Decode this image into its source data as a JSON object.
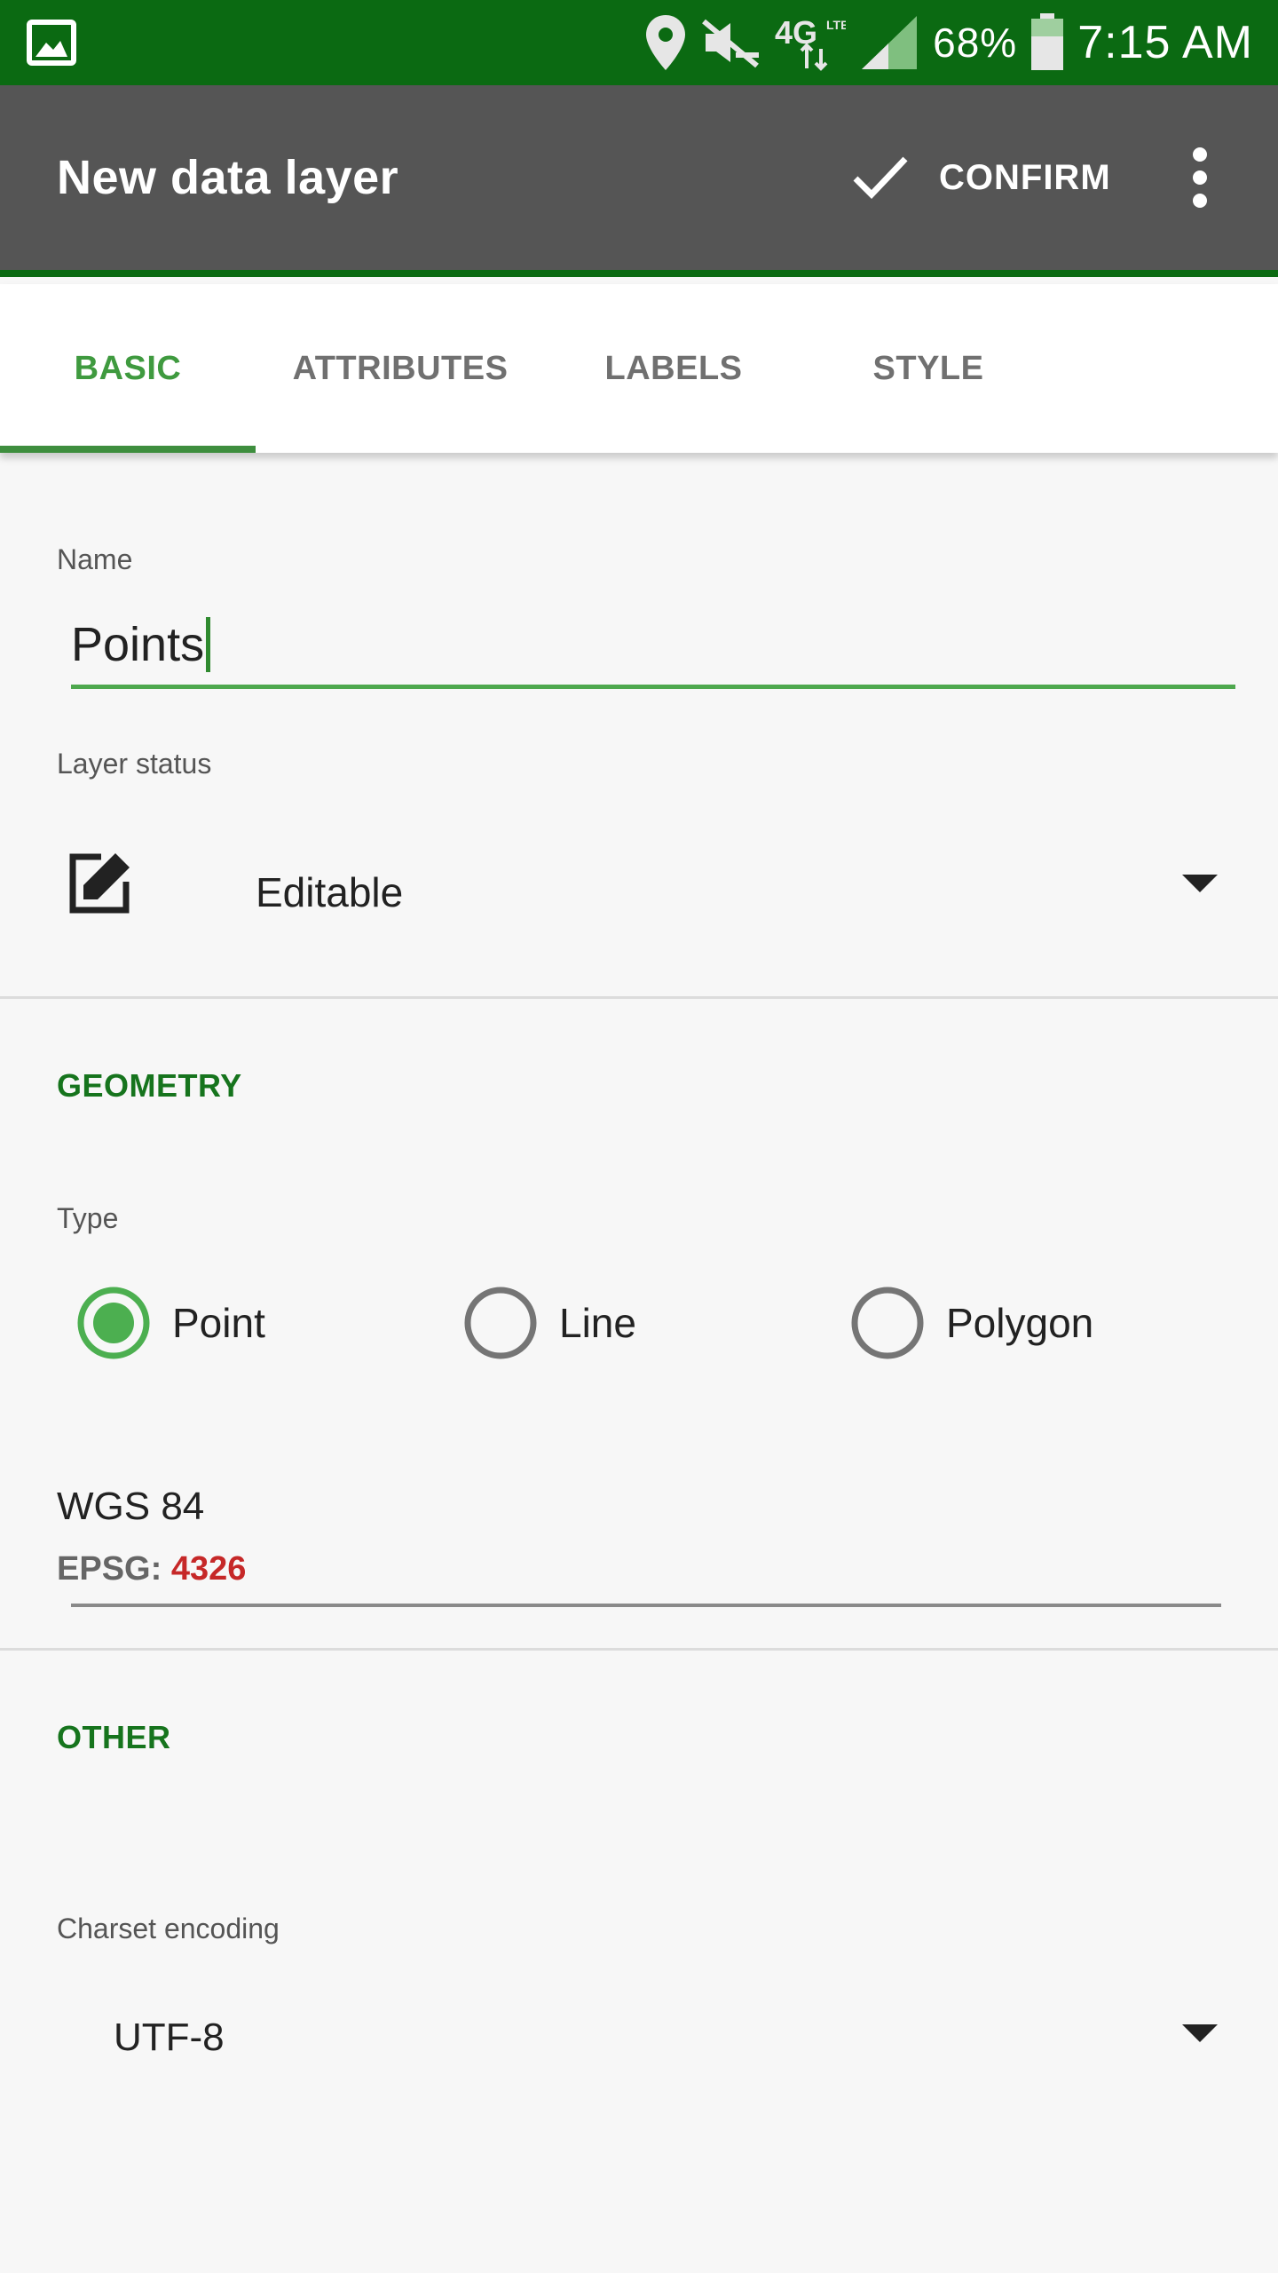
{
  "statusbar": {
    "left_icon": "gallery-icon",
    "icons": [
      "location-icon",
      "mute-icon",
      "4g-lte-icon",
      "signal-icon"
    ],
    "battery_percent": "68%",
    "time": "7:15 AM"
  },
  "appbar": {
    "title": "New data layer",
    "confirm_label": "CONFIRM",
    "confirm_icon": "check-icon",
    "overflow_icon": "more-vert-icon",
    "background": "#555555",
    "accent": "#0b6a12"
  },
  "tabs": {
    "items": [
      {
        "label": "BASIC",
        "active": true
      },
      {
        "label": "ATTRIBUTES",
        "active": false
      },
      {
        "label": "LABELS",
        "active": false
      },
      {
        "label": "STYLE",
        "active": false
      }
    ],
    "active_color": "#3f9a3f"
  },
  "form": {
    "name_label": "Name",
    "name_value": "Points",
    "layer_status_label": "Layer status",
    "layer_status_value": "Editable",
    "layer_status_icon": "edit-icon"
  },
  "geometry": {
    "section_title": "GEOMETRY",
    "type_label": "Type",
    "options": [
      {
        "label": "Point",
        "selected": true
      },
      {
        "label": "Line",
        "selected": false
      },
      {
        "label": "Polygon",
        "selected": false
      }
    ],
    "crs_name": "WGS 84",
    "epsg_prefix": "EPSG:",
    "epsg_code": "4326"
  },
  "other": {
    "section_title": "OTHER",
    "charset_label": "Charset encoding",
    "charset_value": "UTF-8"
  }
}
